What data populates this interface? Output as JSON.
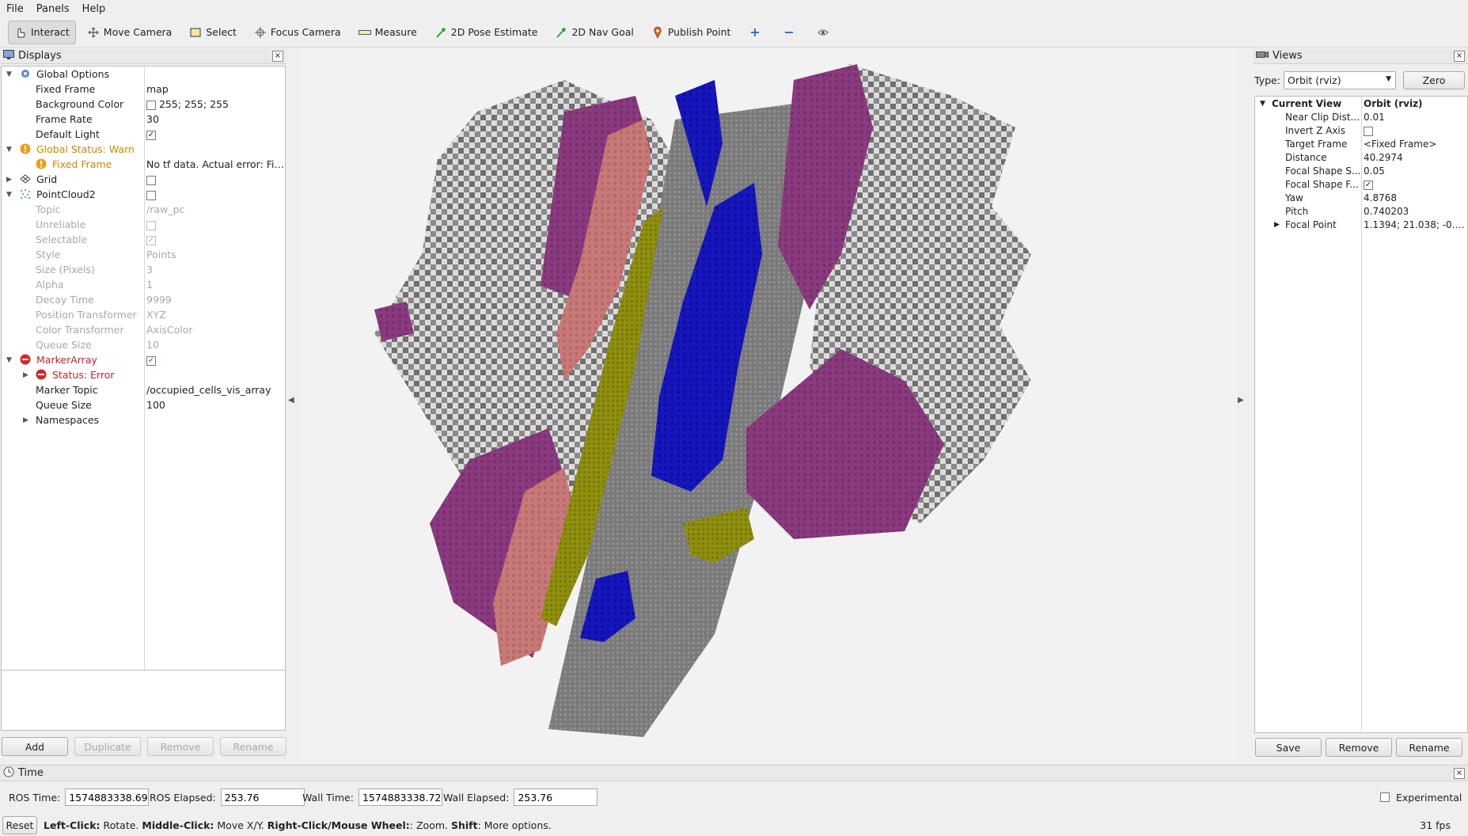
{
  "menubar": {
    "items": [
      "File",
      "Panels",
      "Help"
    ]
  },
  "toolbar": {
    "tools": [
      {
        "label": "Interact",
        "icon": "hand-cursor-icon",
        "active": true
      },
      {
        "label": "Move Camera",
        "icon": "move-arrows-icon"
      },
      {
        "label": "Select",
        "icon": "select-box-icon"
      },
      {
        "label": "Focus Camera",
        "icon": "crosshair-icon"
      },
      {
        "label": "Measure",
        "icon": "ruler-icon"
      },
      {
        "label": "2D Pose Estimate",
        "icon": "green-arrow-icon"
      },
      {
        "label": "2D Nav Goal",
        "icon": "green-arrow-icon"
      },
      {
        "label": "Publish Point",
        "icon": "map-pin-icon"
      }
    ],
    "icon_buttons": [
      "plus-icon",
      "minus-icon",
      "eye-icon"
    ]
  },
  "displays": {
    "title": "Displays",
    "rows": [
      {
        "label": "Global Options",
        "value": ""
      },
      {
        "label": "Fixed Frame",
        "value": "map"
      },
      {
        "label": "Background Color",
        "value": "255; 255; 255"
      },
      {
        "label": "Frame Rate",
        "value": "30"
      },
      {
        "label": "Default Light",
        "value": "✓"
      },
      {
        "label": "Global Status: Warn",
        "value": ""
      },
      {
        "label": "Fixed Frame",
        "value": "No tf data.  Actual error: Fixe..."
      },
      {
        "label": "Grid",
        "value": ""
      },
      {
        "label": "PointCloud2",
        "value": ""
      },
      {
        "label": "Topic",
        "value": "/raw_pc"
      },
      {
        "label": "Unreliable",
        "value": ""
      },
      {
        "label": "Selectable",
        "value": "✓"
      },
      {
        "label": "Style",
        "value": "Points"
      },
      {
        "label": "Size (Pixels)",
        "value": "3"
      },
      {
        "label": "Alpha",
        "value": "1"
      },
      {
        "label": "Decay Time",
        "value": "9999"
      },
      {
        "label": "Position Transformer",
        "value": "XYZ"
      },
      {
        "label": "Color Transformer",
        "value": "AxisColor"
      },
      {
        "label": "Queue Size",
        "value": "10"
      },
      {
        "label": "MarkerArray",
        "value": "✓"
      },
      {
        "label": "Status: Error",
        "value": ""
      },
      {
        "label": "Marker Topic",
        "value": "/occupied_cells_vis_array"
      },
      {
        "label": "Queue Size",
        "value": "100"
      },
      {
        "label": "Namespaces",
        "value": ""
      }
    ],
    "buttons": {
      "add": "Add",
      "duplicate": "Duplicate",
      "remove": "Remove",
      "rename": "Rename"
    }
  },
  "views": {
    "title": "Views",
    "type_label": "Type:",
    "type_value": "Orbit (rviz)",
    "zero": "Zero",
    "rows": [
      {
        "label": "Current View",
        "value": "Orbit (rviz)"
      },
      {
        "label": "Near Clip Dist...",
        "value": "0.01"
      },
      {
        "label": "Invert Z Axis",
        "value": ""
      },
      {
        "label": "Target Frame",
        "value": "<Fixed Frame>"
      },
      {
        "label": "Distance",
        "value": "40.2974"
      },
      {
        "label": "Focal Shape S...",
        "value": "0.05"
      },
      {
        "label": "Focal Shape F...",
        "value": "✓"
      },
      {
        "label": "Yaw",
        "value": "4.8768"
      },
      {
        "label": "Pitch",
        "value": "0.740203"
      },
      {
        "label": "Focal Point",
        "value": "1.1394; 21.038; -0.29..."
      }
    ],
    "buttons": {
      "save": "Save",
      "remove": "Remove",
      "rename": "Rename"
    }
  },
  "time": {
    "title": "Time",
    "ros_time_label": "ROS Time:",
    "ros_time": "1574883338.69",
    "ros_elapsed_label": "ROS Elapsed:",
    "ros_elapsed": "253.76",
    "wall_time_label": "Wall Time:",
    "wall_time": "1574883338.72",
    "wall_elapsed_label": "Wall Elapsed:",
    "wall_elapsed": "253.76",
    "experimental": "Experimental"
  },
  "statusbar": {
    "reset": "Reset",
    "hint_parts": [
      "Left-Click:",
      " Rotate. ",
      "Middle-Click:",
      " Move X/Y. ",
      "Right-Click/Mouse Wheel:",
      ": Zoom. ",
      "Shift",
      ": More options."
    ],
    "fps": "31 fps"
  },
  "colors": {
    "voxel_purple": "#8a3a7e",
    "voxel_salmon": "#c87a78",
    "voxel_blue": "#1414b8",
    "voxel_olive": "#8f8f10",
    "voxel_gray": "#7a7a7a",
    "voxel_light": "#d8d8d8",
    "warn": "#c88a00",
    "error": "#c0262b"
  }
}
